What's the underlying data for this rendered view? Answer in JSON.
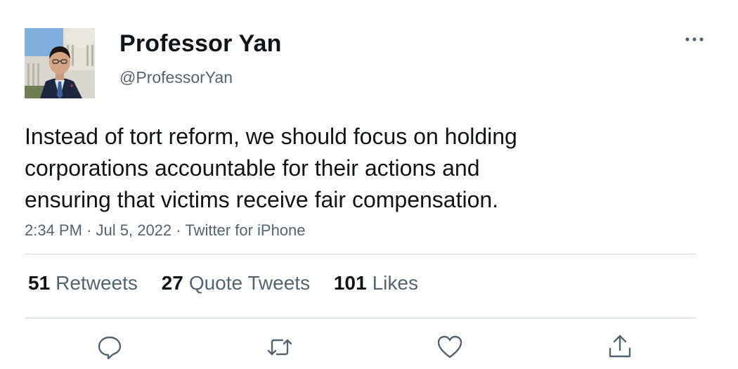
{
  "author": {
    "display_name": "Professor Yan",
    "handle": "@ProfessorYan",
    "avatar_icon": "profile-photo"
  },
  "tweet": {
    "lines": [
      "Instead of tort reform, we should focus on holding",
      "corporations accountable for their actions and",
      "ensuring that victims receive fair compensation."
    ],
    "time": "2:34 PM",
    "date": "Jul 5, 2022",
    "source": "Twitter for iPhone",
    "separator": "·"
  },
  "stats": {
    "retweets": {
      "count": "51",
      "label": "Retweets"
    },
    "quote_tweets": {
      "count": "27",
      "label": "Quote Tweets"
    },
    "likes": {
      "count": "101",
      "label": "Likes"
    }
  },
  "actions": [
    {
      "name": "reply",
      "icon": "speech-bubble-icon"
    },
    {
      "name": "retweet",
      "icon": "retweet-arrows-icon"
    },
    {
      "name": "like",
      "icon": "heart-icon"
    },
    {
      "name": "share",
      "icon": "share-upload-icon"
    }
  ],
  "more_menu": {
    "icon": "more-dots-icon"
  },
  "colors": {
    "text_primary": "#0f1419",
    "text_secondary": "#536471",
    "divider": "#cfd9de",
    "icon": "#536471"
  }
}
